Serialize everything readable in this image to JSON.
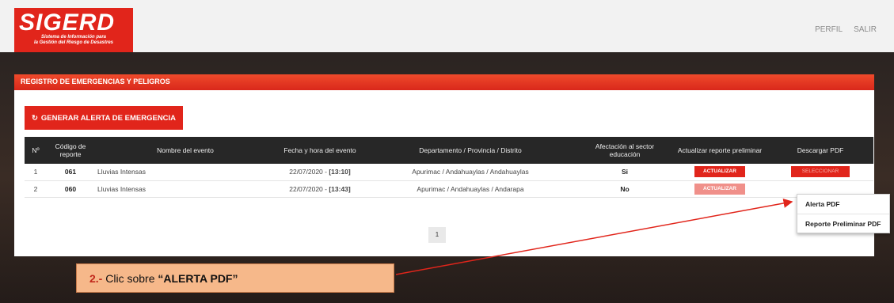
{
  "brand": {
    "title": "SIGERD",
    "subtitle_line1": "Sistema de Información para",
    "subtitle_line2": "la Gestión del Riesgo de Desastres"
  },
  "nav": {
    "perfil": "PERFIL",
    "salir": "SALIR"
  },
  "panel": {
    "header": "REGISTRO DE EMERGENCIAS Y PELIGROS",
    "generate_button": "GENERAR ALERTA DE EMERGENCIA"
  },
  "table": {
    "headers": [
      "Nº",
      "Código de reporte",
      "Nombre del evento",
      "Fecha y hora del evento",
      "Departamento / Provincia / Distrito",
      "Afectación al sector educación",
      "Actualizar reporte preliminar",
      "Descargar PDF"
    ],
    "rows": [
      {
        "num": "1",
        "code": "061",
        "event": "Lluvias Intensas",
        "date": "22/07/2020 - ",
        "time": "[13:10]",
        "location": "Apurimac / Andahuaylas / Andahuaylas",
        "affect": "Si",
        "update": "ACTUALIZAR",
        "download": "SELECCIONAR"
      },
      {
        "num": "2",
        "code": "060",
        "event": "Lluvias Intensas",
        "date": "22/07/2020 - ",
        "time": "[13:43]",
        "location": "Apurimac / Andahuaylas / Andarapa",
        "affect": "No",
        "update": "ACTUALIZAR",
        "download": ""
      }
    ]
  },
  "pagination": {
    "current": "1"
  },
  "dropdown": {
    "items": [
      "Alerta PDF",
      "Reporte Preliminar PDF"
    ]
  },
  "callout": {
    "number": "2.-",
    "text": " Clic sobre ",
    "emphasis": "“ALERTA PDF”"
  },
  "colors": {
    "brand_red": "#e1251b",
    "callout_bg": "#f6b88a",
    "table_header": "#272727"
  }
}
